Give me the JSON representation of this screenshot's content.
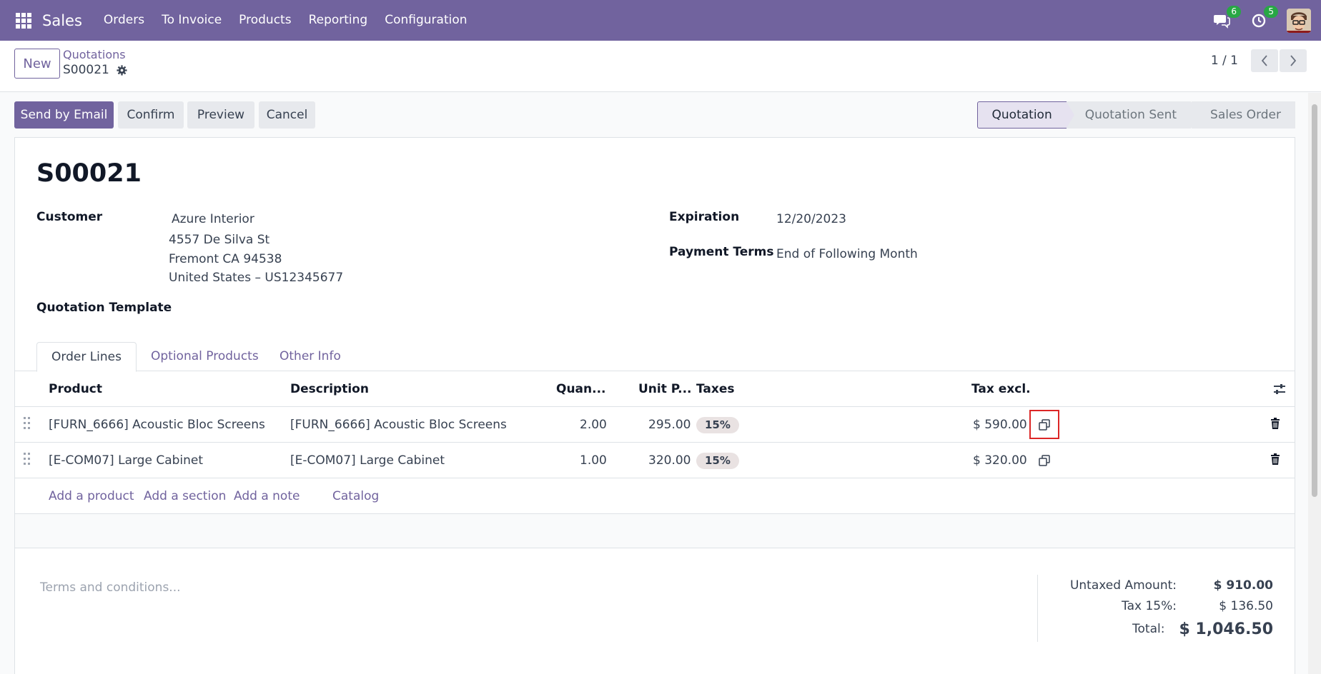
{
  "navbar": {
    "app_name": "Sales",
    "menu": [
      "Orders",
      "To Invoice",
      "Products",
      "Reporting",
      "Configuration"
    ],
    "messages_count": "6",
    "activities_count": "5"
  },
  "control_panel": {
    "new_label": "New",
    "breadcrumb_parent": "Quotations",
    "breadcrumb_current": "S00021",
    "pager_value": "1 / 1"
  },
  "actions": {
    "send_email": "Send by Email",
    "confirm": "Confirm",
    "preview": "Preview",
    "cancel": "Cancel"
  },
  "stages": [
    "Quotation",
    "Quotation Sent",
    "Sales Order"
  ],
  "form": {
    "title": "S00021",
    "customer_label": "Customer",
    "customer_name": "Azure Interior",
    "customer_addr1": "4557 De Silva St",
    "customer_addr2": "Fremont CA 94538",
    "customer_addr3": "United States – US12345677",
    "template_label": "Quotation Template",
    "expiration_label": "Expiration",
    "expiration_value": "12/20/2023",
    "payment_label": "Payment Terms",
    "payment_value": "End of Following Month"
  },
  "tabs": [
    "Order Lines",
    "Optional Products",
    "Other Info"
  ],
  "table": {
    "headers": {
      "product": "Product",
      "description": "Description",
      "quantity": "Quan...",
      "unit_price": "Unit P...",
      "taxes": "Taxes",
      "subtotal": "Tax excl."
    },
    "rows": [
      {
        "product": "[FURN_6666] Acoustic Bloc Screens",
        "description": "[FURN_6666] Acoustic Bloc Screens",
        "quantity": "2.00",
        "unit_price": "295.00",
        "tax": "15%",
        "subtotal": "$ 590.00"
      },
      {
        "product": "[E-COM07] Large Cabinet",
        "description": "[E-COM07] Large Cabinet",
        "quantity": "1.00",
        "unit_price": "320.00",
        "tax": "15%",
        "subtotal": "$ 320.00"
      }
    ],
    "add_links": [
      "Add a product",
      "Add a section",
      "Add a note",
      "Catalog"
    ]
  },
  "terms_placeholder": "Terms and conditions...",
  "totals": {
    "untaxed_label": "Untaxed Amount:",
    "untaxed_value": "$ 910.00",
    "tax_label": "Tax 15%:",
    "tax_value": "$ 136.50",
    "total_label": "Total:",
    "total_value": "$ 1,046.50"
  },
  "colors": {
    "brand": "#71639e",
    "highlight": "#dc2626",
    "badge": "#28a745"
  }
}
